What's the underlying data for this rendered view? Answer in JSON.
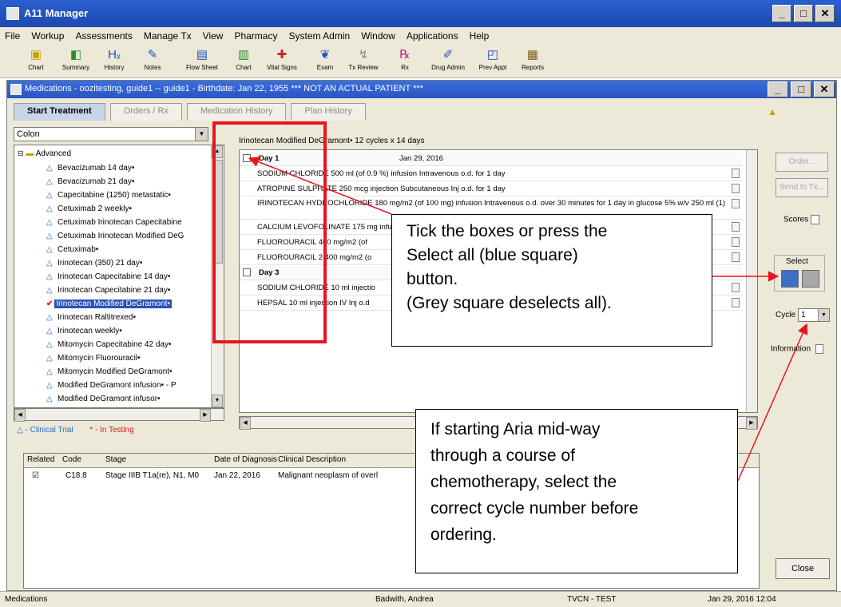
{
  "app": {
    "title": "A11 Manager",
    "menu": [
      "File",
      "Workup",
      "Assessments",
      "Manage Tx",
      "View",
      "Pharmacy",
      "System Admin",
      "Window",
      "Applications",
      "Help"
    ],
    "toolbar": [
      "Chart",
      "Summary",
      "History",
      "Notes",
      "Flow Sheet",
      "Chart",
      "Vital Signs",
      "Exam",
      "Tx Review",
      "Rx",
      "Drug Admin",
      "Prev Appt",
      "Reports"
    ]
  },
  "window": {
    "title": "Medications - oozitesting, guide1 -- guide1 - Birthdate: Jan 22, 1955 *** NOT AN ACTUAL PATIENT ***",
    "tabs": [
      "Start Treatment",
      "Orders / Rx",
      "Medication History",
      "Plan History"
    ]
  },
  "filter": {
    "value": "Colon"
  },
  "tree": {
    "root": "Advanced",
    "items": [
      "Bevacizumab 14 day•",
      "Bevacizumab 21 day•",
      "Capecitabine (1250) metastatic•",
      "Cetuximab 2 weekly•",
      "Cetuximab Irinotecan Capecitabine",
      "Cetuximab Irinotecan Modified DeG",
      "Cetuximab•",
      "Irinotecan (350) 21 day•",
      "Irinotecan Capecitabine 14 day•",
      "Irinotecan Capecitabine 21 day•",
      "Irinotecan Modified DeGramont•",
      "Irinotecan Raltitrexed•",
      "Irinotecan weekly•",
      "Mitomycin Capecitabine 42 day•",
      "Mitomycin Fluorouracil•",
      "Mitomycin Modified DeGramont•",
      "Modified DeGramont infusion• - P",
      "Modified DeGramont infusor•"
    ],
    "selected_index": 10
  },
  "legend": {
    "clinical_trial": "- Clinical Trial",
    "in_testing": "* - In Testing"
  },
  "protocol": {
    "header": "Irinotecan Modified DeGramont•  12 cycles x 14 days",
    "rows": [
      {
        "type": "day",
        "label": "Day 1",
        "date": "Jan 29, 2016"
      },
      {
        "type": "med",
        "text": "SODIUM CHLORIDE 500 ml (of 0.9 %) infusion Intravenous o.d. for 1 day"
      },
      {
        "type": "med",
        "text": "ATROPINE SULPHATE 250 mcg injection Subcutaneous Inj o.d. for 1 day"
      },
      {
        "type": "med",
        "text": "IRINOTECAN HYDROCHLORIDE 180 mg/m2 (of 100 mg) infusion Intravenous o.d. over 30 minutes for 1 day in glucose 5% w/v 250 ml (1)"
      },
      {
        "type": "med",
        "text": "CALCIUM LEVOFOLINATE 175 mg infusion Intravenous o.d. for 1 day (2)"
      },
      {
        "type": "med",
        "text": "FLUOROURACIL 400 mg/m2 (of"
      },
      {
        "type": "med",
        "text": "FLUOROURACIL 2,400 mg/m2 (o"
      },
      {
        "type": "day",
        "label": "Day 3",
        "date": "Jan"
      },
      {
        "type": "med",
        "text": "SODIUM CHLORIDE 10 ml injectio"
      },
      {
        "type": "med",
        "text": "HEPSAL 10 ml injection IV Inj o.d"
      }
    ]
  },
  "side": {
    "order_btn": "Order...",
    "send_btn": "Send to Tx...",
    "scores": "Scores",
    "select": "Select",
    "cycle_label": "Cycle",
    "cycle_value": "1",
    "information": "Information",
    "close": "Close"
  },
  "diagnosis_table": {
    "columns": [
      "Related",
      "Code",
      "Stage",
      "Date of Diagnosis",
      "Clinical Description"
    ],
    "rows": [
      {
        "code": "C18.8",
        "stage": "Stage IIIB T1a(re), N1, M0",
        "date": "Jan 22, 2016",
        "description": "Malignant neoplasm of overl"
      }
    ]
  },
  "status": {
    "left": "Medications",
    "user": "Badwith, Andrea",
    "env": "TVCN - TEST",
    "datetime": "Jan 29, 2016 12:04"
  },
  "annotations": {
    "callout1": [
      "Tick the boxes or press the",
      "Select all (blue square)",
      "button.",
      "(Grey square deselects all)."
    ],
    "callout2": [
      "If starting Aria mid-way",
      "through a course of",
      "chemotherapy, select the",
      "correct cycle number before",
      "ordering."
    ],
    "color": "#e8141e"
  }
}
